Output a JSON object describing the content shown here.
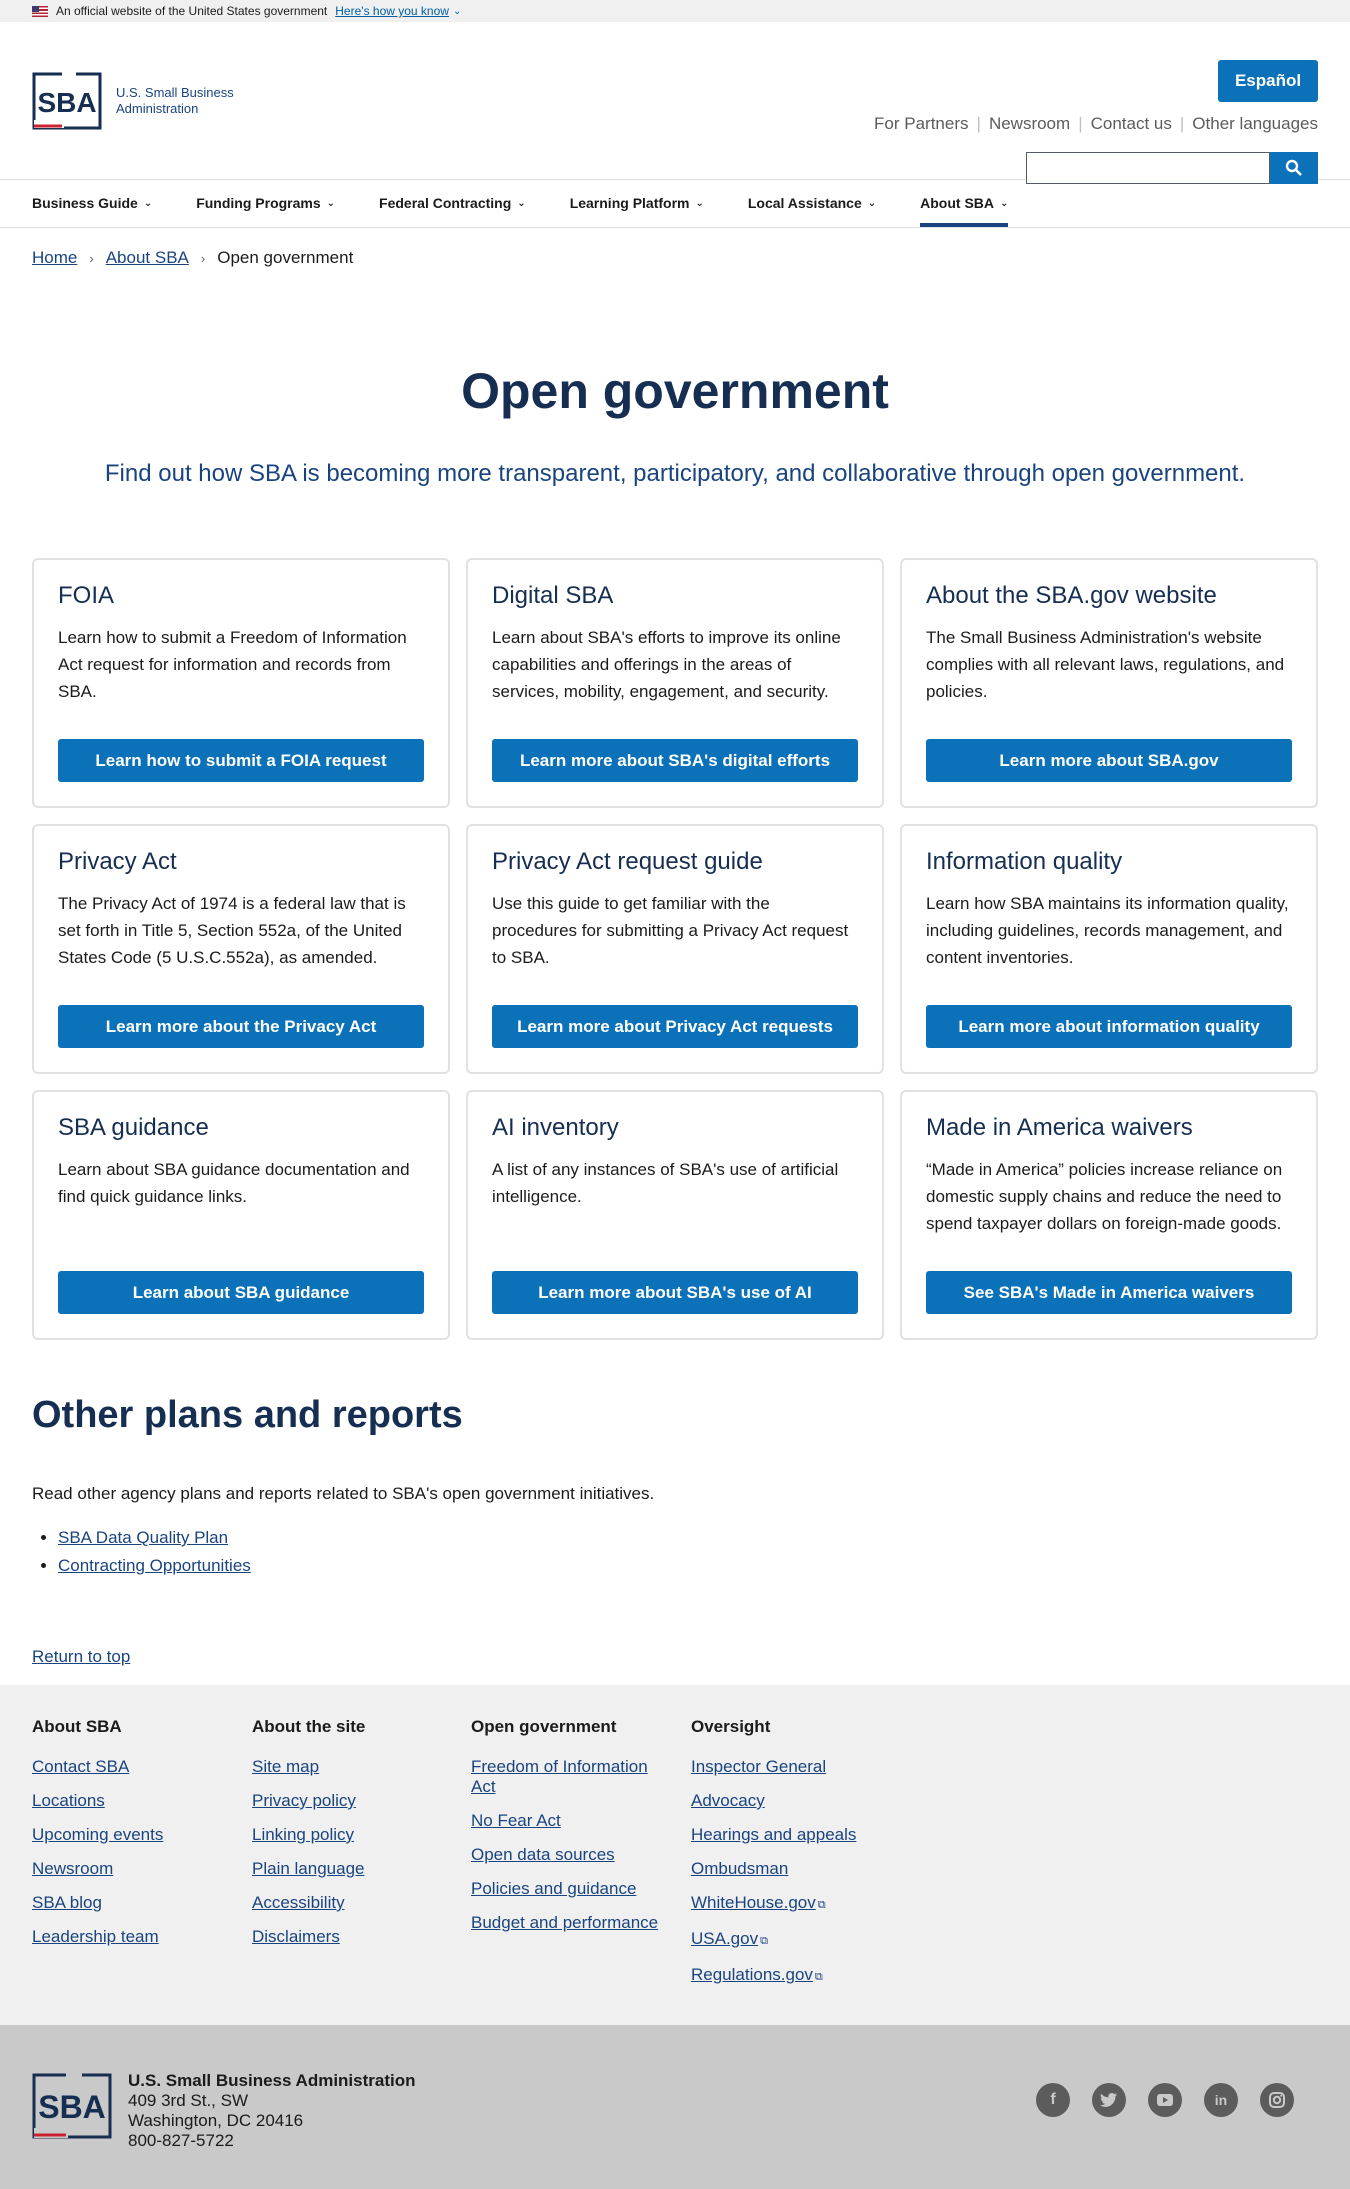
{
  "banner": {
    "text": "An official website of the United States government",
    "link": "Here's how you know"
  },
  "header": {
    "logo_line1": "U.S. Small Business",
    "logo_line2": "Administration",
    "espanol": "Español",
    "util_links": [
      "For Partners",
      "Newsroom",
      "Contact us",
      "Other languages"
    ],
    "search_placeholder": ""
  },
  "nav": {
    "items": [
      "Business Guide",
      "Funding Programs",
      "Federal Contracting",
      "Learning Platform",
      "Local Assistance",
      "About SBA"
    ],
    "active": "About SBA"
  },
  "breadcrumb": {
    "home": "Home",
    "about": "About SBA",
    "current": "Open government"
  },
  "page": {
    "title": "Open government",
    "intro": "Find out how SBA is becoming more transparent, participatory, and collaborative through open government."
  },
  "cards": [
    {
      "title": "FOIA",
      "text": "Learn how to submit a Freedom of Information Act request for information and records from SBA.",
      "button": "Learn how to submit a FOIA request"
    },
    {
      "title": "Digital SBA",
      "text": "Learn about SBA's efforts to improve its online capabilities and offerings in the areas of services, mobility, engagement, and security.",
      "button": "Learn more about SBA's digital efforts"
    },
    {
      "title": "About the SBA.gov website",
      "text": "The Small Business Administration's website complies with all relevant laws, regulations, and policies.",
      "button": "Learn more about SBA.gov"
    },
    {
      "title": "Privacy Act",
      "text": "The Privacy Act of 1974 is a federal law that is set forth in Title 5, Section 552a, of the United States Code (5 U.S.C.552a), as amended.",
      "button": "Learn more about the Privacy Act"
    },
    {
      "title": "Privacy Act request guide",
      "text": "Use this guide to get familiar with the procedures for submitting a Privacy Act request to SBA.",
      "button": "Learn more about Privacy Act requests"
    },
    {
      "title": "Information quality",
      "text": "Learn how SBA maintains its information quality, including guidelines, records management, and content inventories.",
      "button": "Learn more about information quality"
    },
    {
      "title": "SBA guidance",
      "text": "Learn about SBA guidance documentation and find quick guidance links.",
      "button": "Learn about SBA guidance"
    },
    {
      "title": "AI inventory",
      "text": "A list of any instances of SBA's use of artificial intelligence.",
      "button": "Learn more about SBA's use of AI"
    },
    {
      "title": "Made in America waivers",
      "text": "“Made in America” policies increase reliance on domestic supply chains and reduce the need to spend taxpayer dollars on foreign-made goods.",
      "button": "See SBA's Made in America waivers"
    }
  ],
  "other": {
    "title": "Other plans and reports",
    "intro": "Read other agency plans and reports related to SBA's open government initiatives.",
    "links": [
      "SBA Data Quality Plan",
      "Contracting Opportunities"
    ],
    "return_top": "Return to top"
  },
  "footer": {
    "columns": [
      {
        "heading": "About SBA",
        "links": [
          "Contact SBA",
          "Locations",
          "Upcoming events",
          "Newsroom",
          "SBA blog",
          "Leadership team"
        ]
      },
      {
        "heading": "About the site",
        "links": [
          "Site map",
          "Privacy policy",
          "Linking policy",
          "Plain language",
          "Accessibility",
          "Disclaimers"
        ]
      },
      {
        "heading": "Open government",
        "links": [
          "Freedom of Information Act",
          "No Fear Act",
          "Open data sources",
          "Policies and guidance",
          "Budget and performance"
        ]
      },
      {
        "heading": "Oversight",
        "links": [
          "Inspector General",
          "Advocacy",
          "Hearings and appeals",
          "Ombudsman",
          "WhiteHouse.gov",
          "USA.gov",
          "Regulations.gov"
        ]
      }
    ],
    "org_name": "U.S. Small Business Administration",
    "address1": "409 3rd St., SW",
    "address2": "Washington, DC 20416",
    "phone": "800-827-5722",
    "social": [
      "facebook-icon",
      "twitter-icon",
      "youtube-icon",
      "linkedin-icon",
      "instagram-icon"
    ]
  },
  "colors": {
    "primary_button": "#0b72b9",
    "navy": "#162e51",
    "link": "#1a4480",
    "sba_red": "#cc2131"
  }
}
